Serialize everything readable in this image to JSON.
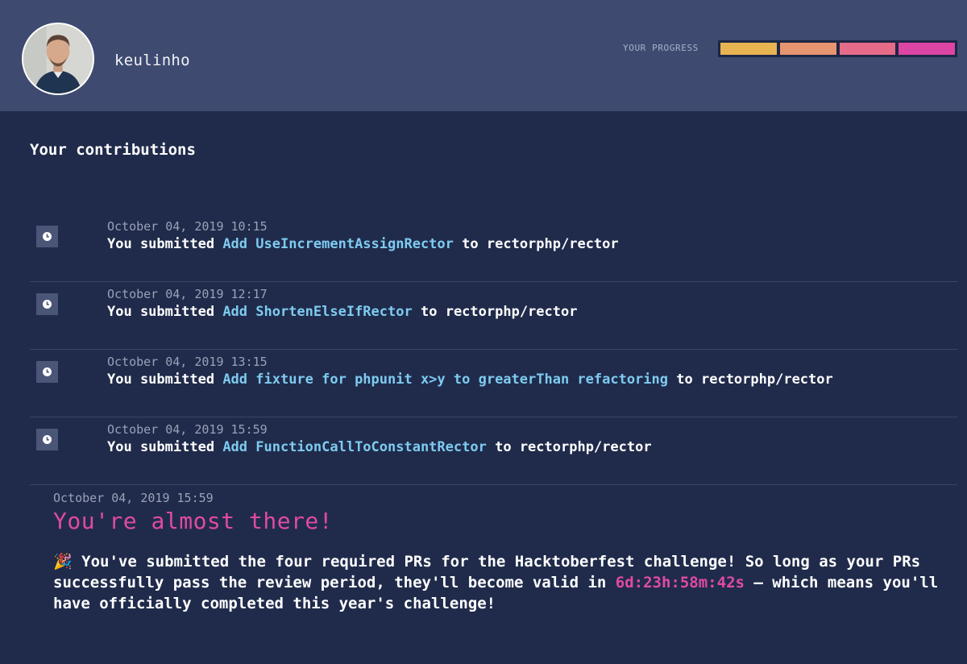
{
  "user": {
    "username": "keulinho"
  },
  "progress": {
    "label": "YOUR PROGRESS",
    "completed_segments": 4,
    "total_segments": 4,
    "segment_colors": [
      "#e8b452",
      "#e79470",
      "#e56b88",
      "#dc45a4"
    ]
  },
  "contributions": {
    "title": "Your contributions",
    "items": [
      {
        "date": "October 04, 2019 10:15",
        "prefix": "You submitted",
        "pr_title": "Add UseIncrementAssignRector",
        "connector": "to",
        "repo": "rectorphp/rector",
        "icon": "clock-icon"
      },
      {
        "date": "October 04, 2019 12:17",
        "prefix": "You submitted",
        "pr_title": "Add ShortenElseIfRector",
        "connector": "to",
        "repo": "rectorphp/rector",
        "icon": "clock-icon"
      },
      {
        "date": "October 04, 2019 13:15",
        "prefix": "You submitted",
        "pr_title": "Add fixture for phpunit x>y to greaterThan refactoring",
        "connector": "to",
        "repo": "rectorphp/rector",
        "icon": "clock-icon"
      },
      {
        "date": "October 04, 2019 15:59",
        "prefix": "You submitted",
        "pr_title": "Add FunctionCallToConstantRector",
        "connector": "to",
        "repo": "rectorphp/rector",
        "icon": "clock-icon"
      }
    ]
  },
  "status_note": {
    "date": "October 04, 2019 15:59",
    "heading": "You're almost there!",
    "emoji": "🎉",
    "text_before": "You've submitted the four required PRs for the Hacktoberfest challenge! So long as your PRs successfully pass the review period, they'll become valid in",
    "countdown": "6d:23h:58m:42s",
    "text_after": "— which means you'll have officially completed this year's challenge!"
  },
  "colors": {
    "background": "#202b4b",
    "header": "#3e4a70",
    "link": "#7ecbf0",
    "accent": "#e04aa4"
  }
}
